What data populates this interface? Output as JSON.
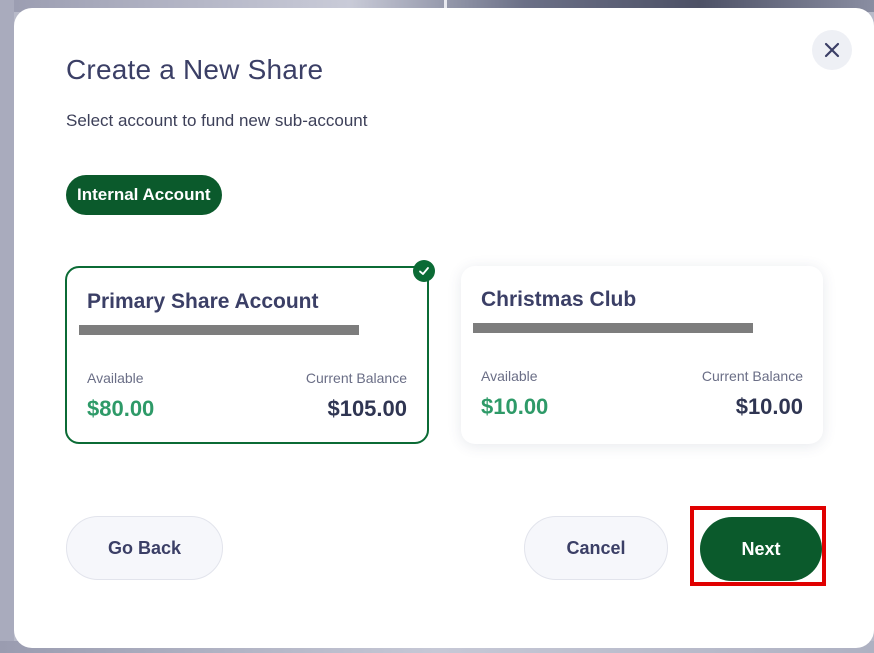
{
  "dialog": {
    "title": "Create a New Share",
    "subtitle": "Select account to fund new sub-account",
    "close_icon": "close-icon"
  },
  "filter": {
    "internal_label": "Internal Account"
  },
  "accounts": [
    {
      "name": "Primary Share Account",
      "available_label": "Available",
      "available": "$80.00",
      "balance_label": "Current Balance",
      "balance": "$105.00",
      "selected": true
    },
    {
      "name": "Christmas Club",
      "available_label": "Available",
      "available": "$10.00",
      "balance_label": "Current Balance",
      "balance": "$10.00",
      "selected": false
    }
  ],
  "actions": {
    "back_label": "Go Back",
    "cancel_label": "Cancel",
    "next_label": "Next"
  },
  "colors": {
    "brand_green": "#0b5a2c",
    "available_green": "#2e9a68",
    "title_navy": "#3b3f66",
    "highlight_red": "#e00000"
  }
}
